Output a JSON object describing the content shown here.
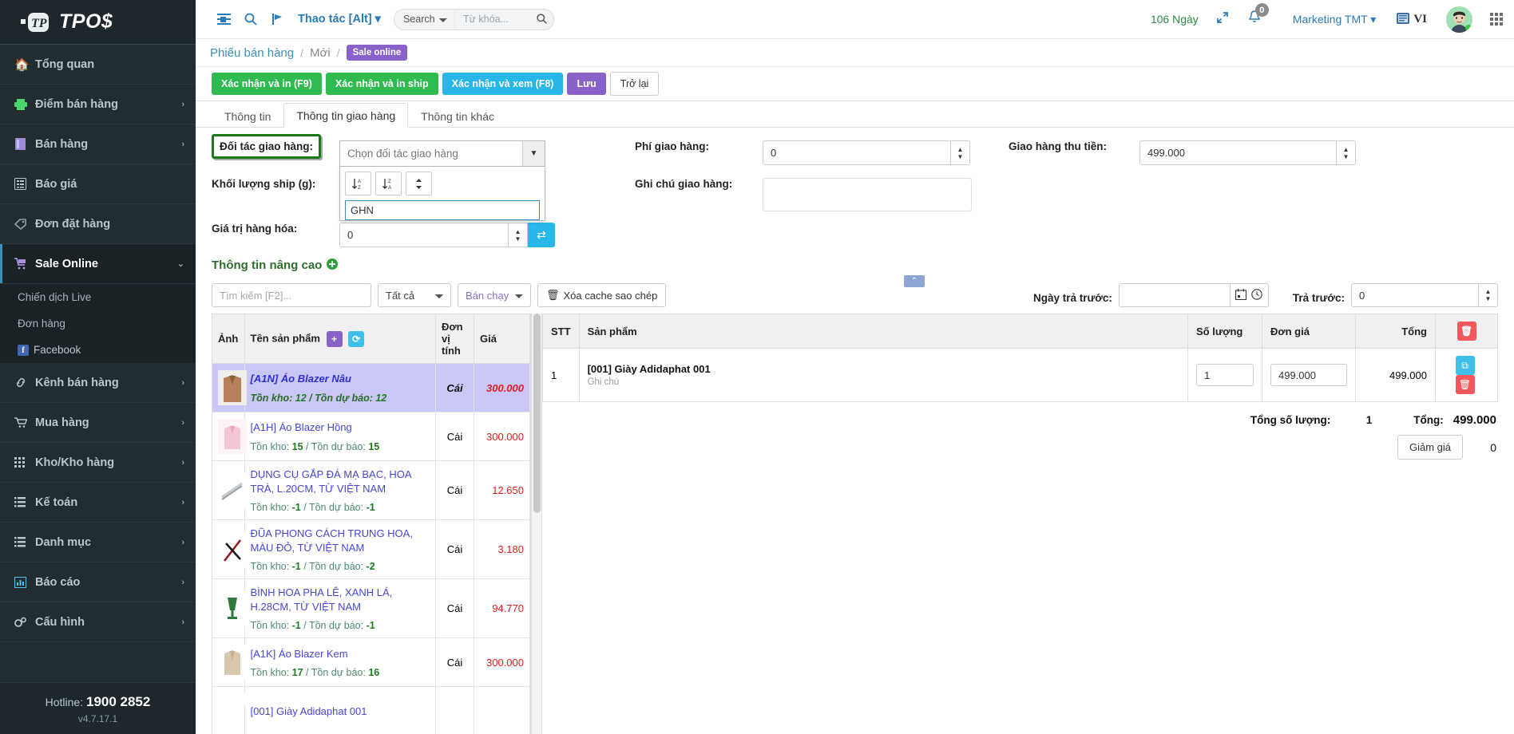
{
  "sidebar": {
    "brand": "TPO$",
    "items": [
      {
        "label": "Tổng quan",
        "icon": "home-icon",
        "arrow": false,
        "active": false
      },
      {
        "label": "Điểm bán hàng",
        "icon": "printer-icon",
        "arrow": true,
        "active": false
      },
      {
        "label": "Bán hàng",
        "icon": "book-icon",
        "arrow": true,
        "active": false
      },
      {
        "label": "Báo giá",
        "icon": "list-alt-icon",
        "arrow": false,
        "active": false
      },
      {
        "label": "Đơn đặt hàng",
        "icon": "tags-icon",
        "arrow": false,
        "active": false
      },
      {
        "label": "Sale Online",
        "icon": "cart-icon",
        "arrow": true,
        "active": true
      }
    ],
    "subitems": [
      {
        "label": "Chiến dịch Live",
        "icon": ""
      },
      {
        "label": "Đơn hàng",
        "icon": ""
      },
      {
        "label": "Facebook",
        "icon": "facebook-icon"
      }
    ],
    "items2": [
      {
        "label": "Kênh bán hàng",
        "icon": "link-icon",
        "arrow": true
      },
      {
        "label": "Mua hàng",
        "icon": "cart2-icon",
        "arrow": true
      },
      {
        "label": "Kho/Kho hàng",
        "icon": "grid-icon",
        "arrow": true
      },
      {
        "label": "Kế toán",
        "icon": "list-icon",
        "arrow": true
      },
      {
        "label": "Danh mục",
        "icon": "list-icon",
        "arrow": true
      },
      {
        "label": "Báo cáo",
        "icon": "chart-icon",
        "arrow": true
      },
      {
        "label": "Cấu hình",
        "icon": "gears-icon",
        "arrow": true
      }
    ],
    "footer": {
      "hotline_label": "Hotline:",
      "hotline_number": "1900 2852",
      "version": "v4.7.17.1"
    }
  },
  "topbar": {
    "action_menu": "Thao tác [Alt]",
    "search_select": "Search",
    "search_placeholder": "Từ khóa...",
    "days": "106 Ngày",
    "notification_count": "0",
    "account": "Marketing TMT",
    "language": "VI"
  },
  "breadcrumb": {
    "root": "Phiếu bán hàng",
    "second": "Mới",
    "badge": "Sale online"
  },
  "toolbar": {
    "confirm_print_f9": "Xác nhận và in (F9)",
    "confirm_print_ship": "Xác nhận và in ship",
    "confirm_view_f8": "Xác nhận và xem (F8)",
    "save": "Lưu",
    "back": "Trở lại"
  },
  "tabs": [
    {
      "label": "Thông tin",
      "active": false
    },
    {
      "label": "Thông tin giao hàng",
      "active": true
    },
    {
      "label": "Thông tin khác",
      "active": false
    }
  ],
  "form": {
    "partner_label": "Đối tác giao hàng:",
    "partner_placeholder": "Chọn đối tác giao hàng",
    "dropdown": {
      "search_value": "GHN",
      "sort_asc": "A-Z",
      "sort_desc": "Z-A",
      "sort_toggle": "both"
    },
    "ship_weight_label": "Khối lượng ship (g):",
    "goods_value_label": "Giá trị hàng hóa:",
    "goods_value": "0",
    "ship_fee_label": "Phí giao hàng:",
    "ship_fee": "0",
    "ship_note_label": "Ghi chú giao hàng:",
    "ship_note": "",
    "cod_label": "Giao hàng thu tiền:",
    "cod": "499.000",
    "advanced_title": "Thông tin nâng cao"
  },
  "filters": {
    "search_placeholder": "Tìm kiếm [F2]...",
    "category": "Tất cả",
    "sort": "Bán chạy",
    "clear_cache": "Xóa cache sao chép",
    "prepay_date_label": "Ngày trả trước:",
    "prepay_date": "",
    "prepay_label": "Trả trước:",
    "prepay": "0"
  },
  "product_table": {
    "headers": {
      "image": "Ảnh",
      "name": "Tên sản phẩm",
      "unit": "Đơn vị tính",
      "price": "Giá"
    },
    "rows": [
      {
        "name": "[A1N] Áo Blazer Nâu",
        "stock_label": "Tồn kho:",
        "stock": "12",
        "forecast_label": "Tồn dự báo:",
        "forecast": "12",
        "unit": "Cái",
        "price": "300.000",
        "selected": true,
        "color": "#b4815a"
      },
      {
        "name": "[A1H] Áo Blazer Hồng",
        "stock_label": "Tồn kho:",
        "stock": "15",
        "forecast_label": "Tồn dự báo:",
        "forecast": "15",
        "unit": "Cái",
        "price": "300.000",
        "selected": false,
        "color": "#f4c5d3"
      },
      {
        "name": "DỤNG CỤ GẮP ĐÁ MẠ BẠC, HOA TRÀ, L.20CM, TỪ VIỆT NAM",
        "stock_label": "Tồn kho:",
        "stock": "-1",
        "forecast_label": "Tồn dự báo:",
        "forecast": "-1",
        "unit": "Cái",
        "price": "12.650",
        "selected": false,
        "color": "#c8ccd0"
      },
      {
        "name": "ĐŨA PHONG CÁCH TRUNG HOA, MÀU ĐỎ, TỪ VIỆT NAM",
        "stock_label": "Tồn kho:",
        "stock": "-1",
        "forecast_label": "Tồn dự báo:",
        "forecast": "-2",
        "unit": "Cái",
        "price": "3.180",
        "selected": false,
        "color": "#8d2020"
      },
      {
        "name": "BÌNH HOA PHA LÊ, XANH LÁ, H.28CM, TỪ VIỆT NAM",
        "stock_label": "Tồn kho:",
        "stock": "-1",
        "forecast_label": "Tồn dự báo:",
        "forecast": "-1",
        "unit": "Cái",
        "price": "94.770",
        "selected": false,
        "color": "#2f7a3a"
      },
      {
        "name": "[A1K] Áo Blazer Kem",
        "stock_label": "Tồn kho:",
        "stock": "17",
        "forecast_label": "Tồn dự báo:",
        "forecast": "16",
        "unit": "Cái",
        "price": "300.000",
        "selected": false,
        "color": "#d8c8ae"
      },
      {
        "name": "[001] Giày Adidaphat 001",
        "stock_label": "",
        "stock": "",
        "forecast_label": "",
        "forecast": "",
        "unit": "",
        "price": "",
        "selected": false,
        "color": "#bfbfbf"
      }
    ]
  },
  "order_table": {
    "headers": {
      "stt": "STT",
      "product": "Sản phẩm",
      "qty": "Số lượng",
      "unit_price": "Đơn giá",
      "total": "Tổng",
      "delete": "delete-icon"
    },
    "rows": [
      {
        "stt": "1",
        "product": "[001] Giày Adidaphat 001",
        "note": "Ghi chú",
        "qty": "1",
        "unit_price": "499.000",
        "total": "499.000"
      }
    ],
    "summary": {
      "qty_label": "Tổng số lượng:",
      "qty_value": "1",
      "total_label": "Tổng:",
      "total_value": "499.000",
      "discount_label": "Giảm giá",
      "discount_value": "0"
    }
  },
  "colors": {
    "sidebar_bg": "#222d32",
    "accent_blue": "#3c8dbc",
    "green": "#2fbb4f",
    "purple": "#8862c8",
    "cyan": "#29b6e8",
    "red": "#e02020",
    "highlight_green_border": "#1a7a1a"
  }
}
